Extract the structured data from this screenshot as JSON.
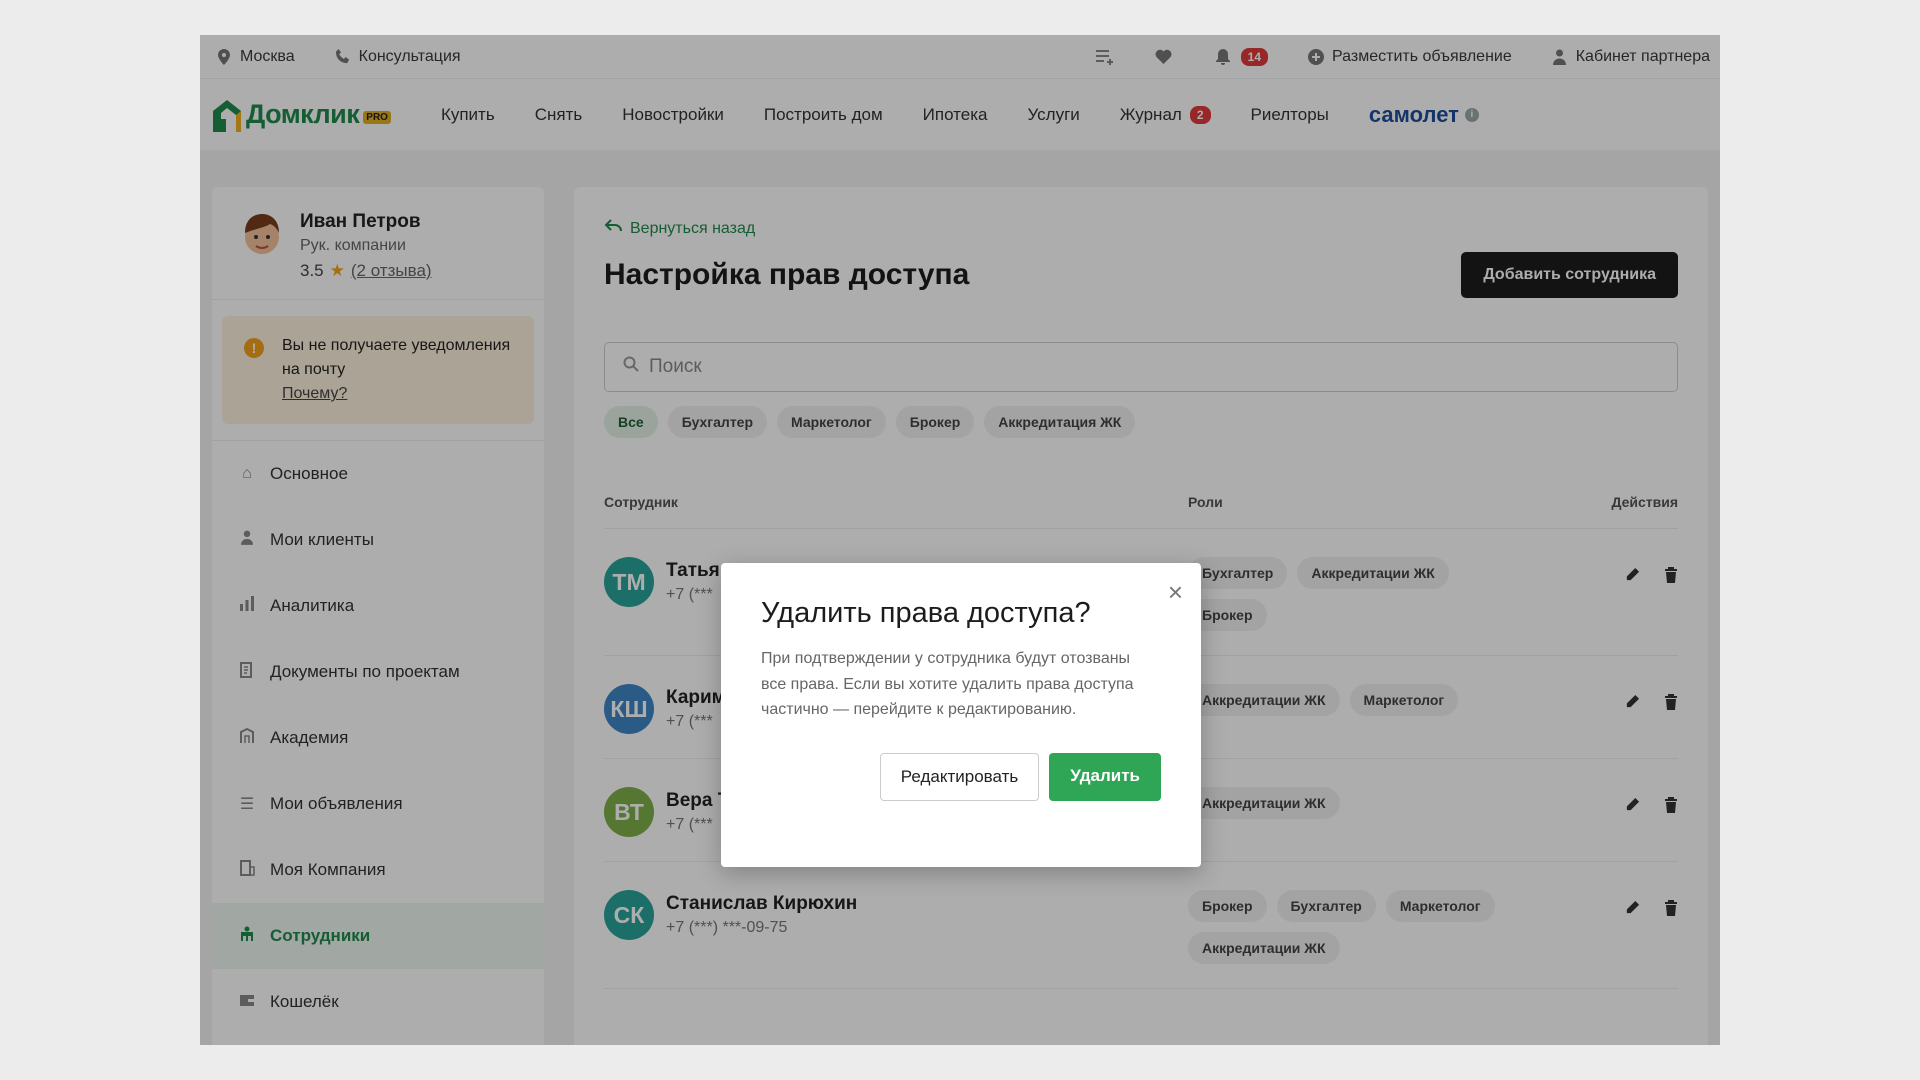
{
  "topbar": {
    "city": "Москва",
    "consultation": "Консультация",
    "notifications_count": "14",
    "post_ad": "Разместить объявление",
    "partner_cabinet": "Кабинет партнера"
  },
  "nav": {
    "logo_text": "Домклик",
    "logo_badge": "PRO",
    "links": [
      "Купить",
      "Снять",
      "Новостройки",
      "Построить дом",
      "Ипотека",
      "Услуги"
    ],
    "journal": "Журнал",
    "journal_count": "2",
    "realtors": "Риелторы",
    "samolet": "самолет"
  },
  "profile": {
    "name": "Иван Петров",
    "role": "Рук. компании",
    "rating": "3.5",
    "reviews": "(2 отзыва)"
  },
  "notice": {
    "text": "Вы не получаете уведомления на почту",
    "why": "Почему?"
  },
  "menu": [
    {
      "label": "Основное",
      "icon": "home-icon"
    },
    {
      "label": "Мои клиенты",
      "icon": "user-icon"
    },
    {
      "label": "Аналитика",
      "icon": "bar-chart-icon"
    },
    {
      "label": "Документы по проектам",
      "icon": "document-icon"
    },
    {
      "label": "Академия",
      "icon": "academy-icon"
    },
    {
      "label": "Мои объявления",
      "icon": "list-icon"
    },
    {
      "label": "Моя Компания",
      "icon": "company-icon"
    },
    {
      "label": "Сотрудники",
      "icon": "team-icon"
    },
    {
      "label": "Кошелёк",
      "icon": "wallet-icon"
    }
  ],
  "main": {
    "back": "Вернуться назад",
    "title": "Настройка прав доступа",
    "add_button": "Добавить сотрудника",
    "search_placeholder": "Поиск",
    "filters": [
      "Все",
      "Бухгалтер",
      "Маркетолог",
      "Брокер",
      "Аккредитация ЖК"
    ],
    "columns": {
      "employee": "Сотрудник",
      "roles": "Роли",
      "actions": "Действия"
    },
    "rows": [
      {
        "initials": "ТМ",
        "name": "Татья",
        "phone": "+7 (***",
        "color": "#2aa39a",
        "roles": [
          "Бухгалтер",
          "Аккредитации ЖК",
          "Брокер"
        ]
      },
      {
        "initials": "КШ",
        "name": "Карим",
        "phone": "+7 (***",
        "color": "#3d86c6",
        "roles": [
          "Аккредитации ЖК",
          "Маркетолог"
        ]
      },
      {
        "initials": "ВТ",
        "name": "Вера Т",
        "phone": "+7 (***",
        "color": "#7fb04a",
        "roles": [
          "Аккредитации ЖК"
        ]
      },
      {
        "initials": "СК",
        "name": "Станислав Кирюхин",
        "phone": "+7 (***) ***-09-75",
        "color": "#2aa39a",
        "roles": [
          "Брокер",
          "Бухгалтер",
          "Маркетолог",
          "Аккредитации ЖК"
        ]
      }
    ]
  },
  "modal": {
    "title": "Удалить права доступа?",
    "text": "При подтверждении у сотрудника будут отозваны все права. Если вы хотите удалить права доступа частично — перейдите к редактированию.",
    "edit": "Редактировать",
    "delete": "Удалить"
  },
  "colors": {
    "brand_green": "#1f8a4c",
    "delete_button": "#2fa556",
    "badge_red": "#e03a3a"
  }
}
